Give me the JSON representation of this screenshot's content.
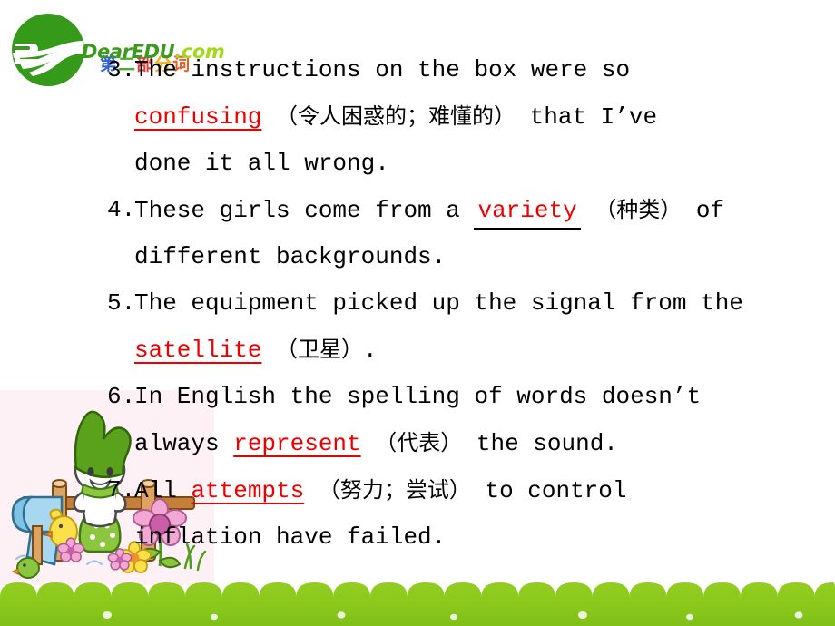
{
  "logo": {
    "name_main": "DearEDU",
    "name_tld": ".com",
    "mark": "swoosh-circle-icon"
  },
  "decoration": {
    "watermark_chars": [
      "第",
      "二",
      "部",
      "分",
      "词"
    ],
    "colors": [
      "#2f5fd0",
      "#49b02c",
      "#e0403a",
      "#f0b21c",
      "#e2622a"
    ]
  },
  "illustration": {
    "name": "bunny-mailbox-fence-illustration",
    "background": "#fdf1f5",
    "elements": [
      "green-hooded-bunny",
      "blue-mailbox",
      "yellow-chick",
      "wooden-fence",
      "pink-flower",
      "green-grass"
    ]
  },
  "theme": {
    "answer_color": "#ee0000",
    "text_color": "#000000",
    "footer_green": "#8dc81e",
    "logo_green": "#3a9b1c",
    "logo_lime": "#a3d91a",
    "panel_pink": "#fdf1f5"
  },
  "exercises": [
    {
      "number": "3.",
      "lines": [
        [
          {
            "t": "text",
            "v": "The instructions on the box were so"
          }
        ],
        [
          {
            "t": "answer",
            "v": "confusing"
          },
          {
            "t": "text",
            "v": " "
          },
          {
            "t": "cn",
            "v": "（令人困惑的；难懂的）"
          },
          {
            "t": "text",
            "v": " that I’ve"
          }
        ],
        [
          {
            "t": "text",
            "v": "done it all wrong."
          }
        ]
      ]
    },
    {
      "number": "4.",
      "lines": [
        [
          {
            "t": "text",
            "v": "These girls come from a "
          },
          {
            "t": "answer-pad",
            "v": "variety"
          },
          {
            "t": "text",
            "v": " "
          },
          {
            "t": "cn",
            "v": "（种类）"
          },
          {
            "t": "text",
            "v": " of"
          }
        ],
        [
          {
            "t": "text",
            "v": "different backgrounds."
          }
        ]
      ]
    },
    {
      "number": "5.",
      "lines": [
        [
          {
            "t": "text",
            "v": "The equipment picked up the signal from the"
          }
        ],
        [
          {
            "t": "answer",
            "v": "satellite"
          },
          {
            "t": "text",
            "v": "  "
          },
          {
            "t": "cn",
            "v": "（卫星）"
          },
          {
            "t": "text",
            "v": "."
          }
        ]
      ]
    },
    {
      "number": "6.",
      "lines": [
        [
          {
            "t": "text",
            "v": "In English the spelling of words doesn’t"
          }
        ],
        [
          {
            "t": "text",
            "v": "always "
          },
          {
            "t": "answer",
            "v": "represent"
          },
          {
            "t": "text",
            "v": " "
          },
          {
            "t": "cn",
            "v": "（代表）"
          },
          {
            "t": "text",
            "v": " the sound."
          }
        ]
      ]
    },
    {
      "number": "7.",
      "lines": [
        [
          {
            "t": "text",
            "v": "All "
          },
          {
            "t": "answer",
            "v": "attempts"
          },
          {
            "t": "text",
            "v": " "
          },
          {
            "t": "cn",
            "v": "（努力；尝试）"
          },
          {
            "t": "text",
            "v": " to control"
          }
        ],
        [
          {
            "t": "text",
            "v": "inflation have failed."
          }
        ]
      ]
    }
  ]
}
